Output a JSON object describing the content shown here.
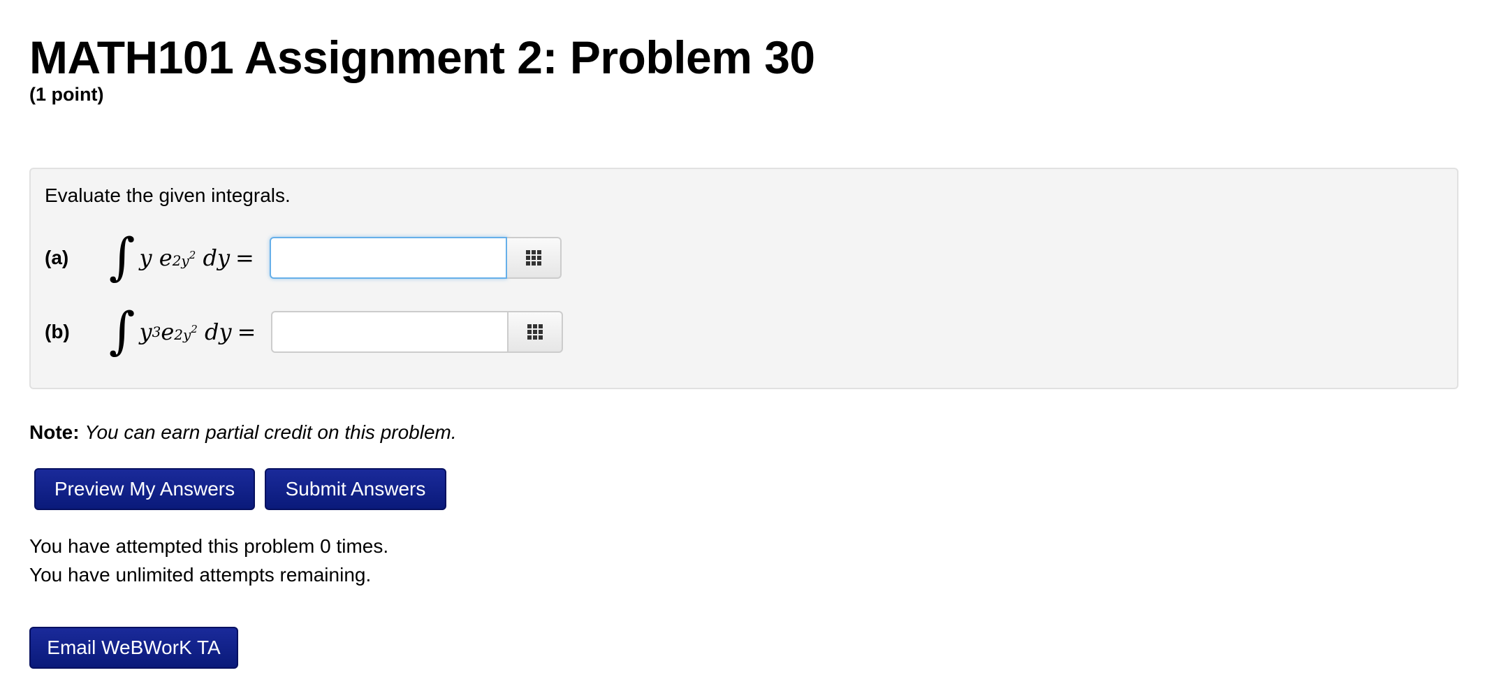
{
  "header": {
    "title": "MATH101 Assignment 2: Problem 30",
    "points": "(1 point)"
  },
  "problem": {
    "instruction": "Evaluate the given integrals.",
    "parts": [
      {
        "label": "(a)",
        "answer_value": "",
        "answer_focused": true
      },
      {
        "label": "(b)",
        "answer_value": "",
        "answer_focused": false
      }
    ]
  },
  "note": {
    "label": "Note:",
    "text": "You can earn partial credit on this problem."
  },
  "buttons": {
    "preview_label": "Preview My Answers",
    "submit_label": "Submit Answers",
    "email_label": "Email WeBWorK TA"
  },
  "status": {
    "attempts_text": "You have attempted this problem 0 times.",
    "remaining_text": "You have unlimited attempts remaining."
  },
  "icons": {
    "equation_editor": "grid-icon"
  },
  "colors": {
    "button_bg": "#0a1a7a",
    "box_bg": "#f4f4f4",
    "focus_border": "#66afe9"
  }
}
